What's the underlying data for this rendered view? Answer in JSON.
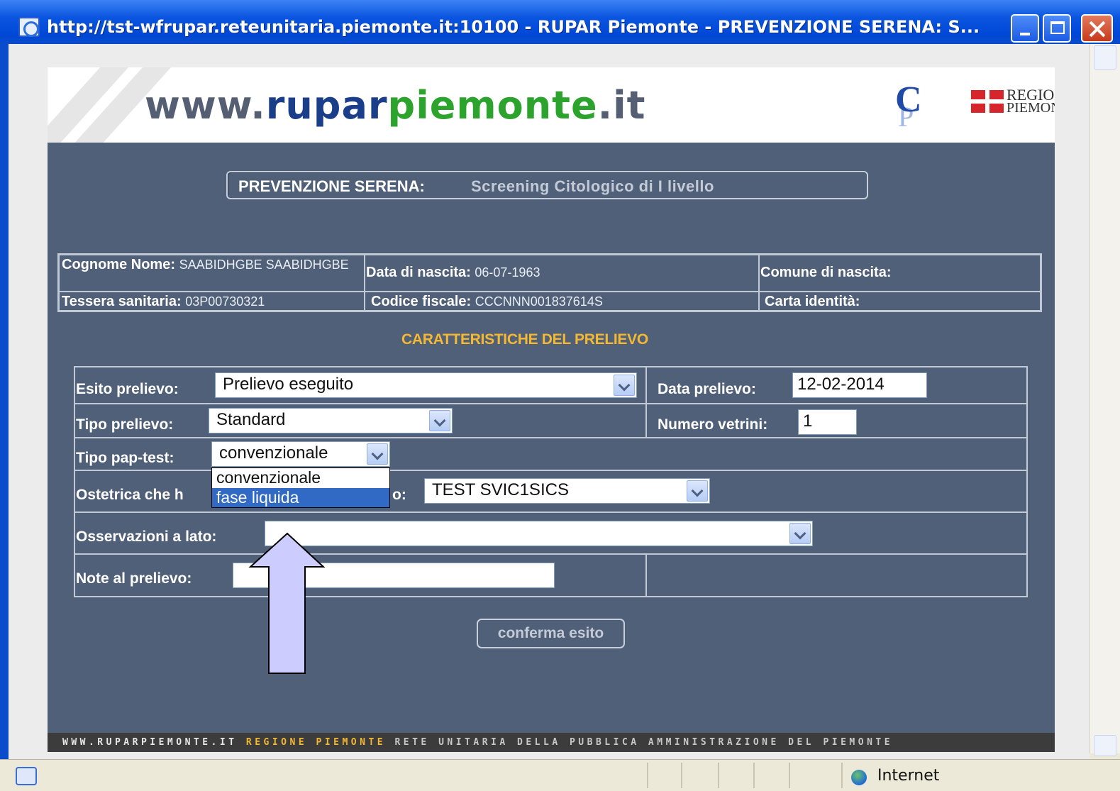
{
  "window": {
    "title": "http://tst-wfrupar.reteunitaria.piemonte.it:10100 - RUPAR Piemonte - PREVENZIONE SERENA: S..."
  },
  "header": {
    "logo_prefix": "www.",
    "logo_mid": "rupar",
    "logo_green": "piemonte",
    "logo_suffix": ".it",
    "csi_logo_c": "C",
    "csi_logo_p": "P",
    "regione_line1": "REGIONE",
    "regione_line2": "PIEMONTE"
  },
  "page_title": {
    "prefix": "PREVENZIONE SERENA:",
    "text": "Screening Citologico di I livello"
  },
  "patient": {
    "name_label": "Cognome Nome:",
    "name_value": "SAABIDHGBE SAABIDHGBE",
    "birth_label": "Data di nascita:",
    "birth_value": "06-07-1963",
    "comune_label": "Comune di nascita:",
    "tessera_label": "Tessera sanitaria:",
    "tessera_value": "03P00730321",
    "codice_label": "Codice fiscale:",
    "codice_value": "CCCNNN001837614S",
    "carta_label": "Carta identità:"
  },
  "section_title": "CARATTERISTICHE DEL PRELIEVO",
  "form": {
    "esito_label": "Esito prelievo:",
    "esito_value": "Prelievo eseguito",
    "data_label": "Data prelievo:",
    "data_value": "12-02-2014",
    "tipo_label": "Tipo prelievo:",
    "tipo_value": "Standard",
    "vetrini_label": "Numero vetrini:",
    "vetrini_value": "1",
    "pap_label": "Tipo pap-test:",
    "pap_value": "convenzionale",
    "pap_options": [
      "convenzionale",
      "fase liquida"
    ],
    "ostetrica_label_start": "Ostetrica che h",
    "ostetrica_label_end": "o:",
    "ostetrica_value": "TEST SVIC1SICS",
    "osservazioni_label": "Osservazioni a lato:",
    "osservazioni_value": "",
    "note_label": "Note al prelievo:",
    "note_value": ""
  },
  "confirm_label": "conferma esito",
  "footer": {
    "part1": "WWW.RUPARPIEMONTE.IT",
    "part2": "REGIONE PIEMONTE",
    "part3": "RETE UNITARIA DELLA PUBBLICA AMMINISTRAZIONE DEL PIEMONTE"
  },
  "statusbar": {
    "zone": "Internet"
  },
  "colors": {
    "page_bg": "#506079",
    "section_title": "#f5b931",
    "selection": "#316ac5",
    "annotation_arrow": "#ccccff"
  },
  "icons": {
    "ie_icon": "ie-page-icon",
    "minimize": "minimize-icon",
    "maximize": "maximize-icon",
    "close": "close-icon",
    "globe": "globe-icon"
  }
}
